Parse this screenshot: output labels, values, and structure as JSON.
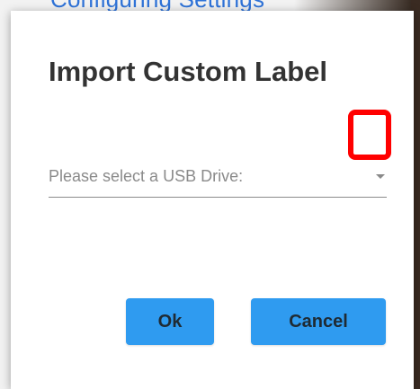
{
  "background": {
    "link_text": "Configuring Settings"
  },
  "dialog": {
    "title": "Import Custom Label",
    "usb_select": {
      "placeholder": "Please select a USB Drive:",
      "selected_value": ""
    },
    "buttons": {
      "ok_label": "Ok",
      "cancel_label": "Cancel"
    }
  },
  "icons": {
    "dropdown": "chevron-down-icon"
  },
  "colors": {
    "button_bg": "#2f9bf0",
    "highlight": "#ff0000",
    "title_text": "#333333",
    "placeholder_text": "#8a8a8a",
    "link": "#2f73d8"
  }
}
